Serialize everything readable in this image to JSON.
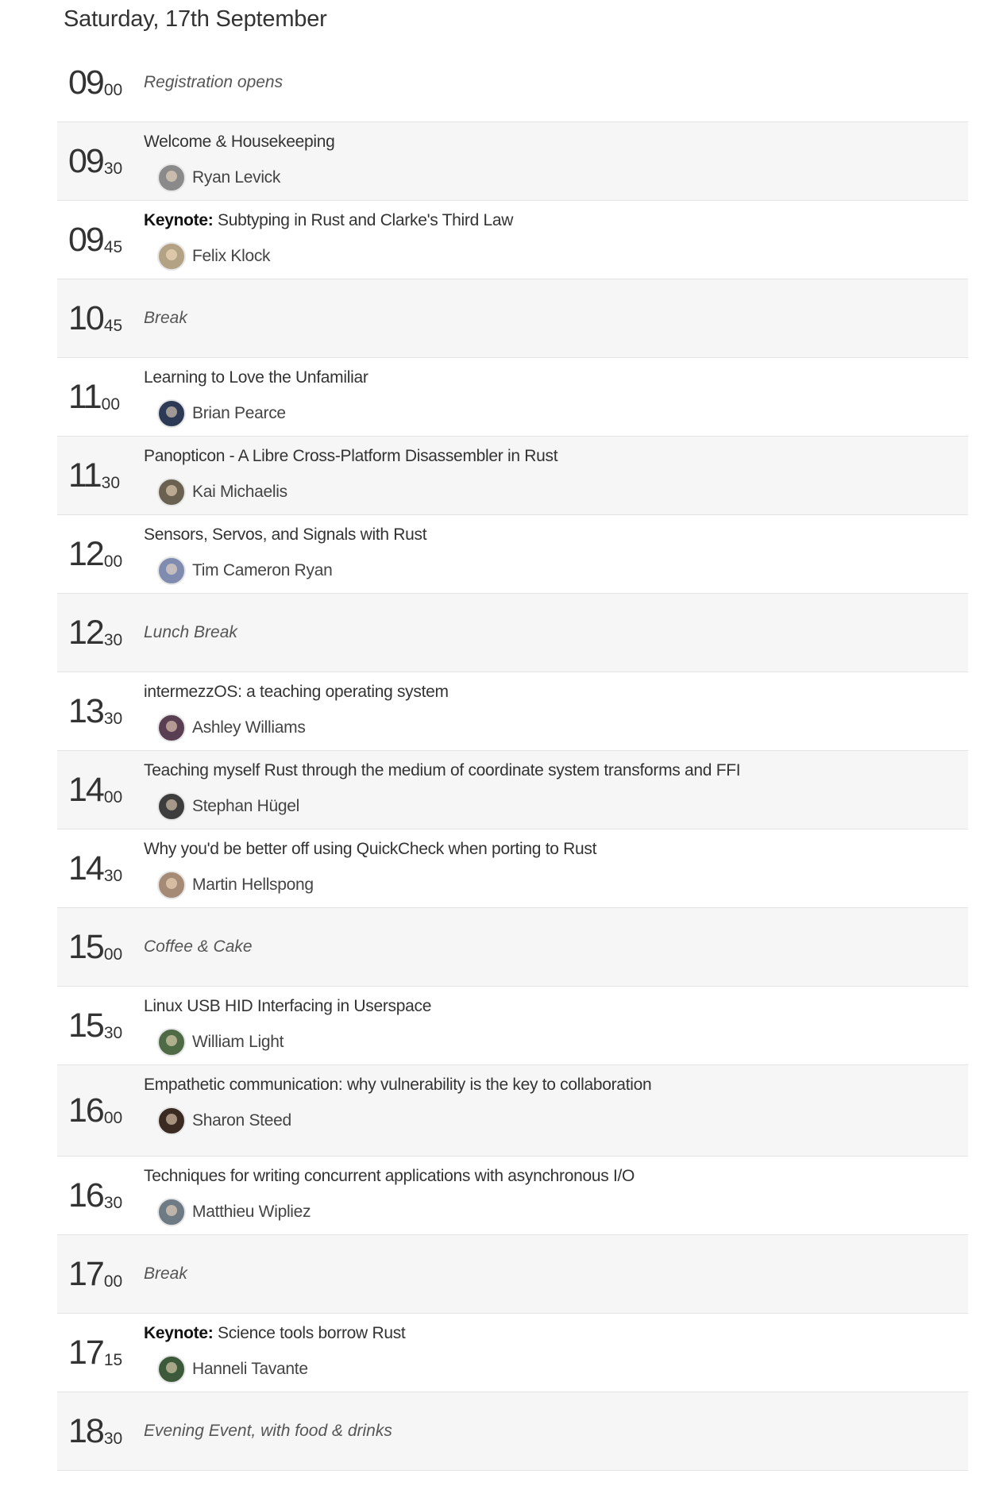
{
  "day": {
    "heading": "Saturday, 17th September"
  },
  "schedule": [
    {
      "kind": "break",
      "hour": "09",
      "minute": "00",
      "label": "Registration opens",
      "shaded": false
    },
    {
      "kind": "talk",
      "hour": "09",
      "minute": "30",
      "prefix": "",
      "title": "Welcome & Housekeeping",
      "speaker": "Ryan Levick",
      "avatar_color": "#8a8a8a",
      "shaded": true
    },
    {
      "kind": "talk",
      "hour": "09",
      "minute": "45",
      "prefix": "Keynote:",
      "title": " Subtyping in Rust and Clarke's Third Law",
      "speaker": "Felix Klock",
      "avatar_color": "#b3a284",
      "shaded": false
    },
    {
      "kind": "break",
      "hour": "10",
      "minute": "45",
      "label": "Break",
      "shaded": true
    },
    {
      "kind": "talk",
      "hour": "11",
      "minute": "00",
      "prefix": "",
      "title": "Learning to Love the Unfamiliar",
      "speaker": "Brian Pearce",
      "avatar_color": "#2c3a55",
      "shaded": false
    },
    {
      "kind": "talk",
      "hour": "11",
      "minute": "30",
      "prefix": "",
      "title": "Panopticon - A Libre Cross-Platform Disassembler in Rust",
      "speaker": "Kai Michaelis",
      "avatar_color": "#6b6150",
      "shaded": true
    },
    {
      "kind": "talk",
      "hour": "12",
      "minute": "00",
      "prefix": "",
      "title": "Sensors, Servos, and Signals with Rust",
      "speaker": "Tim Cameron Ryan",
      "avatar_color": "#7f8cb0",
      "shaded": false
    },
    {
      "kind": "break",
      "hour": "12",
      "minute": "30",
      "label": "Lunch Break",
      "shaded": true
    },
    {
      "kind": "talk",
      "hour": "13",
      "minute": "30",
      "prefix": "",
      "title": "intermezzOS: a teaching operating system",
      "speaker": "Ashley Williams",
      "avatar_color": "#5a3e52",
      "shaded": false
    },
    {
      "kind": "talk",
      "hour": "14",
      "minute": "00",
      "prefix": "",
      "title": "Teaching myself Rust through the medium of coordinate system transforms and FFI",
      "speaker": "Stephan Hügel",
      "avatar_color": "#3d3d3d",
      "shaded": true
    },
    {
      "kind": "talk",
      "hour": "14",
      "minute": "30",
      "prefix": "",
      "title": "Why you'd be better off using QuickCheck when porting to Rust",
      "speaker": "Martin Hellspong",
      "avatar_color": "#a58a76",
      "shaded": false
    },
    {
      "kind": "break",
      "hour": "15",
      "minute": "00",
      "label": "Coffee & Cake",
      "shaded": true
    },
    {
      "kind": "talk",
      "hour": "15",
      "minute": "30",
      "prefix": "",
      "title": "Linux USB HID Interfacing in Userspace",
      "speaker": "William Light",
      "avatar_color": "#4f6b46",
      "shaded": false
    },
    {
      "kind": "talk",
      "hour": "16",
      "minute": "00",
      "prefix": "",
      "title": "Empathetic communication: why vulnerability is the key to collaboration",
      "speaker": "Sharon Steed",
      "avatar_color": "#3a2a22",
      "shaded": true,
      "tall": true
    },
    {
      "kind": "talk",
      "hour": "16",
      "minute": "30",
      "prefix": "",
      "title": "Techniques for writing concurrent applications with asynchronous I/O",
      "speaker": "Matthieu Wipliez",
      "avatar_color": "#6e7a84",
      "shaded": false
    },
    {
      "kind": "break",
      "hour": "17",
      "minute": "00",
      "label": "Break",
      "shaded": true
    },
    {
      "kind": "talk",
      "hour": "17",
      "minute": "15",
      "prefix": "Keynote:",
      "title": " Science tools borrow Rust",
      "speaker": "Hanneli Tavante",
      "avatar_color": "#3c5a3a",
      "shaded": false
    },
    {
      "kind": "break",
      "hour": "18",
      "minute": "30",
      "label": "Evening Event, with food & drinks",
      "shaded": true
    }
  ]
}
